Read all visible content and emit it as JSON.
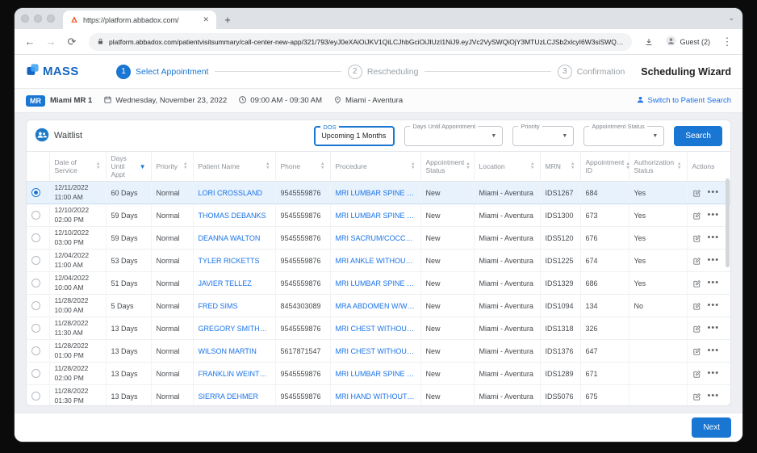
{
  "browser": {
    "tab_title": "https://platform.abbadox.com/",
    "url": "platform.abbadox.com/patientvisitsummary/call-center-new-app/321/793/eyJ0eXAiOiJKV1QiLCJhbGciOiJIUzI1NiJ9.eyJVc2VySWQiOjY3MTUzLCJSb2xlcyI6W3siSWQiOjksIlVzZXJSb2xlTmFtZSI6Ik9mZmljZSBNYW5hZ2VyIn1dLCJDbGllbnRJZCI6IjMyMSIsIkNsaW5pY0lkIjoiNzkzIn0.ZSBNYW5hZ2VySXNX",
    "profile_label": "Guest (2)"
  },
  "header": {
    "logo_text": "MASS",
    "wizard_title": "Scheduling Wizard",
    "steps": [
      {
        "number": "1",
        "label": "Select Appointment"
      },
      {
        "number": "2",
        "label": "Rescheduling"
      },
      {
        "number": "3",
        "label": "Confirmation"
      }
    ]
  },
  "appointment_bar": {
    "badge": "MR",
    "resource": "Miami MR 1",
    "date": "Wednesday, November 23, 2022",
    "time": "09:00 AM - 09:30 AM",
    "location": "Miami - Aventura",
    "switch_link": "Switch to Patient Search"
  },
  "waitlist": {
    "title": "Waitlist",
    "filters": {
      "dos": {
        "label": "DOS",
        "value": "Upcoming 1 Months"
      },
      "days_until": {
        "label": "Days Until Appointment",
        "value": ""
      },
      "priority": {
        "label": "Priority",
        "value": ""
      },
      "appointment_status": {
        "label": "Appointment Status",
        "value": ""
      }
    },
    "search_label": "Search"
  },
  "table": {
    "columns": [
      "Date of Service",
      "Days Until Appt",
      "Priority",
      "Patient Name",
      "Phone",
      "Procedure",
      "Appointment Status",
      "Location",
      "MRN",
      "Appointment ID",
      "Authorization Status",
      "Actions"
    ],
    "rows": [
      {
        "selected": true,
        "date": "12/11/2022",
        "time": "11:00 AM",
        "days": "60 Days",
        "priority": "Normal",
        "name": "LORI CROSSLAND",
        "phone": "9545559876",
        "procedure": "MRI LUMBAR SPINE WIT...",
        "status": "New",
        "location": "Miami - Aventura",
        "mrn": "IDS1267",
        "appt_id": "684",
        "auth": "Yes"
      },
      {
        "selected": false,
        "date": "12/10/2022",
        "time": "02:00 PM",
        "days": "59 Days",
        "priority": "Normal",
        "name": "THOMAS DEBANKS",
        "phone": "9545559876",
        "procedure": "MRI LUMBAR SPINE WIT...",
        "status": "New",
        "location": "Miami - Aventura",
        "mrn": "IDS1300",
        "appt_id": "673",
        "auth": "Yes"
      },
      {
        "selected": false,
        "date": "12/10/2022",
        "time": "03:00 PM",
        "days": "59 Days",
        "priority": "Normal",
        "name": "DEANNA WALTON",
        "phone": "9545559876",
        "procedure": "MRI SACRUM/COCCYX ...",
        "status": "New",
        "location": "Miami - Aventura",
        "mrn": "IDS5120",
        "appt_id": "676",
        "auth": "Yes"
      },
      {
        "selected": false,
        "date": "12/04/2022",
        "time": "11:00 AM",
        "days": "53 Days",
        "priority": "Normal",
        "name": "TYLER RICKETTS",
        "phone": "9545559876",
        "procedure": "MRI ANKLE WITHOUT(7...",
        "status": "New",
        "location": "Miami - Aventura",
        "mrn": "IDS1225",
        "appt_id": "674",
        "auth": "Yes"
      },
      {
        "selected": false,
        "date": "12/04/2022",
        "time": "10:00 AM",
        "days": "51 Days",
        "priority": "Normal",
        "name": "JAVIER TELLEZ",
        "phone": "9545559876",
        "procedure": "MRI LUMBAR SPINE WIT...",
        "status": "New",
        "location": "Miami - Aventura",
        "mrn": "IDS1329",
        "appt_id": "686",
        "auth": "Yes"
      },
      {
        "selected": false,
        "date": "11/28/2022",
        "time": "10:00 AM",
        "days": "5 Days",
        "priority": "Normal",
        "name": "FRED SIMS",
        "phone": "8454303089",
        "procedure": "MRA ABDOMEN W/WO(7...",
        "status": "New",
        "location": "Miami - Aventura",
        "mrn": "IDS1094",
        "appt_id": "134",
        "auth": "No"
      },
      {
        "selected": false,
        "date": "11/28/2022",
        "time": "11:30 AM",
        "days": "13 Days",
        "priority": "Normal",
        "name": "GREGORY SMITHSON",
        "phone": "9545559876",
        "procedure": "MRI CHEST WITHOUT(7...",
        "status": "New",
        "location": "Miami - Aventura",
        "mrn": "IDS1318",
        "appt_id": "326",
        "auth": ""
      },
      {
        "selected": false,
        "date": "11/28/2022",
        "time": "01:00 PM",
        "days": "13 Days",
        "priority": "Normal",
        "name": "WILSON MARTIN",
        "phone": "5617871547",
        "procedure": "MRI CHEST WITHOUT(7...",
        "status": "New",
        "location": "Miami - Aventura",
        "mrn": "IDS1376",
        "appt_id": "647",
        "auth": ""
      },
      {
        "selected": false,
        "date": "11/28/2022",
        "time": "02:00 PM",
        "days": "13 Days",
        "priority": "Normal",
        "name": "FRANKLIN WEINTRAUB",
        "phone": "9545559876",
        "procedure": "MRI LUMBAR SPINE W/...",
        "status": "New",
        "location": "Miami - Aventura",
        "mrn": "IDS1289",
        "appt_id": "671",
        "auth": ""
      },
      {
        "selected": false,
        "date": "11/28/2022",
        "time": "01:30 PM",
        "days": "13 Days",
        "priority": "Normal",
        "name": "SIERRA DEHMER",
        "phone": "9545559876",
        "procedure": "MRI HAND WITHOUT(73...",
        "status": "New",
        "location": "Miami - Aventura",
        "mrn": "IDS5076",
        "appt_id": "675",
        "auth": ""
      }
    ]
  },
  "footer": {
    "next_label": "Next"
  }
}
